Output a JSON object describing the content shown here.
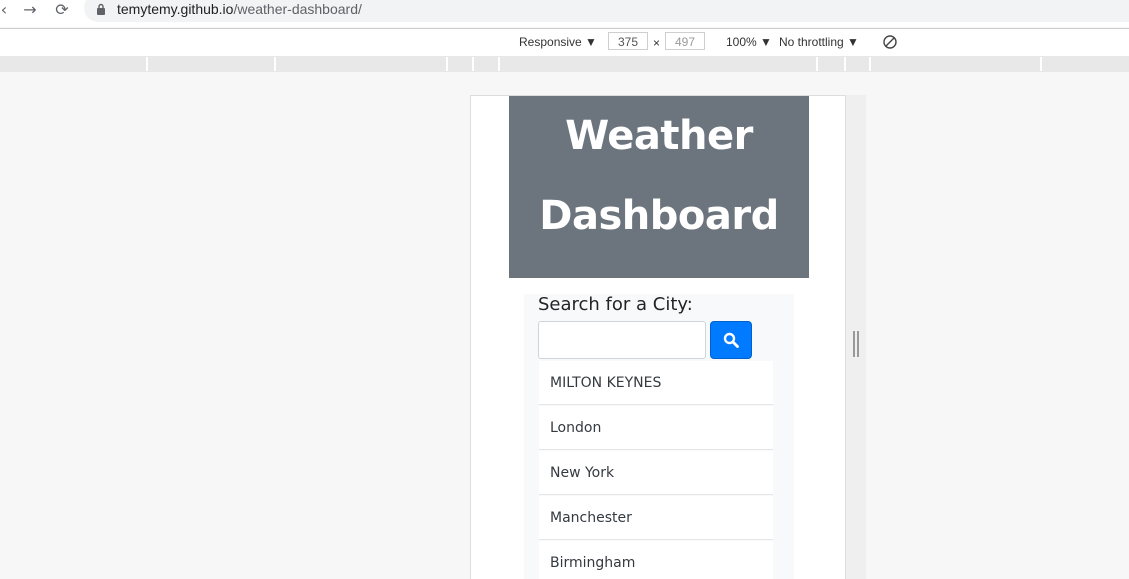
{
  "browser": {
    "url_host": "temytemy.github.io",
    "url_path": "/weather-dashboard/"
  },
  "device_toolbar": {
    "device": "Responsive",
    "width": "375",
    "times": "×",
    "height": "497",
    "zoom": "100%",
    "throttling": "No throttling"
  },
  "page": {
    "title_line1": "Weather",
    "title_line2": "Dashboard",
    "search_label": "Search for a City:",
    "search_value": "",
    "history": [
      "MILTON KEYNES",
      "London",
      "New York",
      "Manchester",
      "Birmingham"
    ]
  },
  "colors": {
    "header_bg": "#6c757d",
    "search_button": "#007bff"
  }
}
